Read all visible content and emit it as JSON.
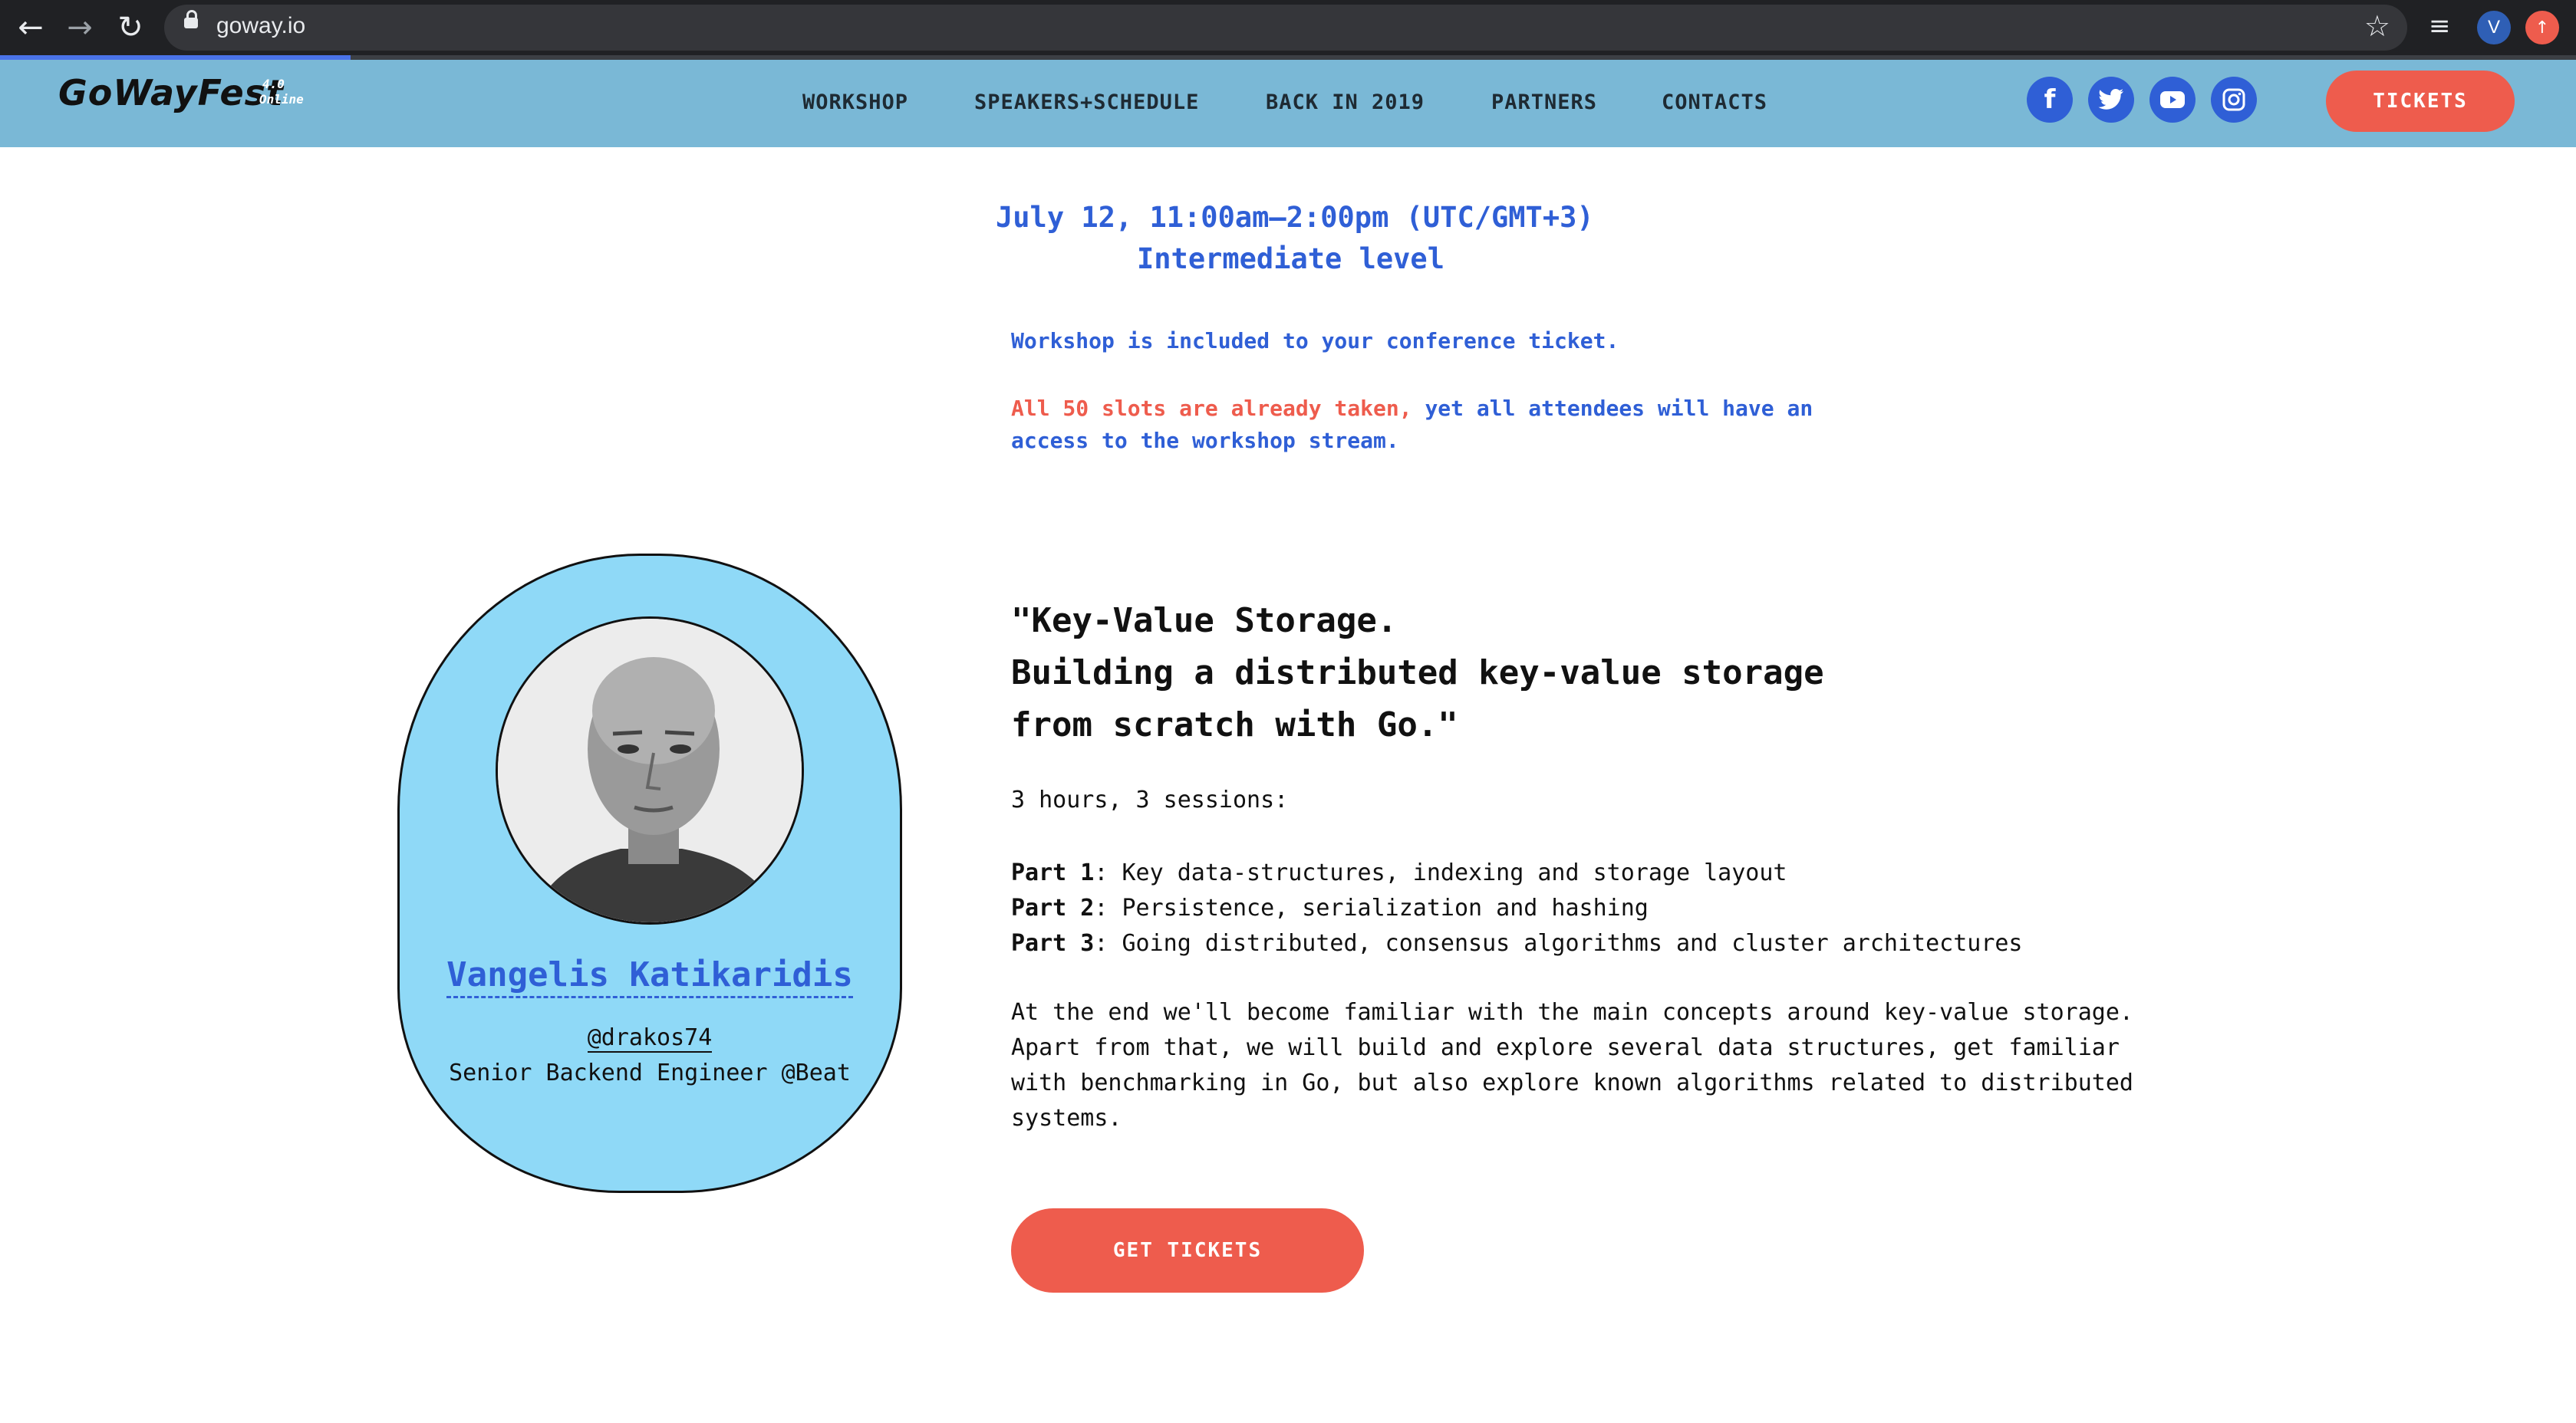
{
  "browser": {
    "url": "goway.io",
    "avatar_letter": "V"
  },
  "header": {
    "logo_text": "GoWayFest",
    "logo_version": "4.0",
    "logo_edition": "Online",
    "nav": [
      "WORKSHOP",
      "SPEAKERS+SCHEDULE",
      "BACK IN 2019",
      "PARTNERS",
      "CONTACTS"
    ],
    "social": [
      "facebook",
      "twitter",
      "youtube",
      "instagram"
    ],
    "tickets_label": "TICKETS",
    "load_progress": 0.136
  },
  "intro": {
    "date": "July 12, 11:00am–2:00pm (UTC/GMT+3)",
    "level": "Intermediate level",
    "included": "Workshop is included to your conference ticket.",
    "slots_taken": "All 50 slots are already taken,",
    "stream_note": " yet all attendees will have an access to the workshop stream."
  },
  "speaker": {
    "name": "Vangelis Katikaridis",
    "handle": "@drakos74",
    "role": "Senior Backend Engineer @Beat"
  },
  "talk": {
    "title_lines": [
      "\"Key-Value Storage.",
      "Building a distributed key-value storage",
      "from scratch with Go.\""
    ],
    "duration": "3 hours, 3 sessions:",
    "parts": [
      {
        "label": "Part 1",
        "text": ": Key data-structures, indexing and storage layout"
      },
      {
        "label": "Part 2",
        "text": ": Persistence, serialization and hashing"
      },
      {
        "label": "Part 3",
        "text": ": Going distributed, consensus algorithms and cluster architectures"
      }
    ],
    "description_lines": [
      "At the end we'll become familiar with the main concepts around key-value storage.",
      "Apart from that, we will build and explore several data structures, get familiar",
      "with benchmarking in Go, but also explore known algorithms related to distributed",
      "systems."
    ],
    "cta_label": "GET TICKETS"
  },
  "colors": {
    "header_bg": "#7ab8d6",
    "accent_blue": "#2f5fd6",
    "accent_red": "#ee5c4d",
    "card_bg": "#8fd9f7"
  }
}
